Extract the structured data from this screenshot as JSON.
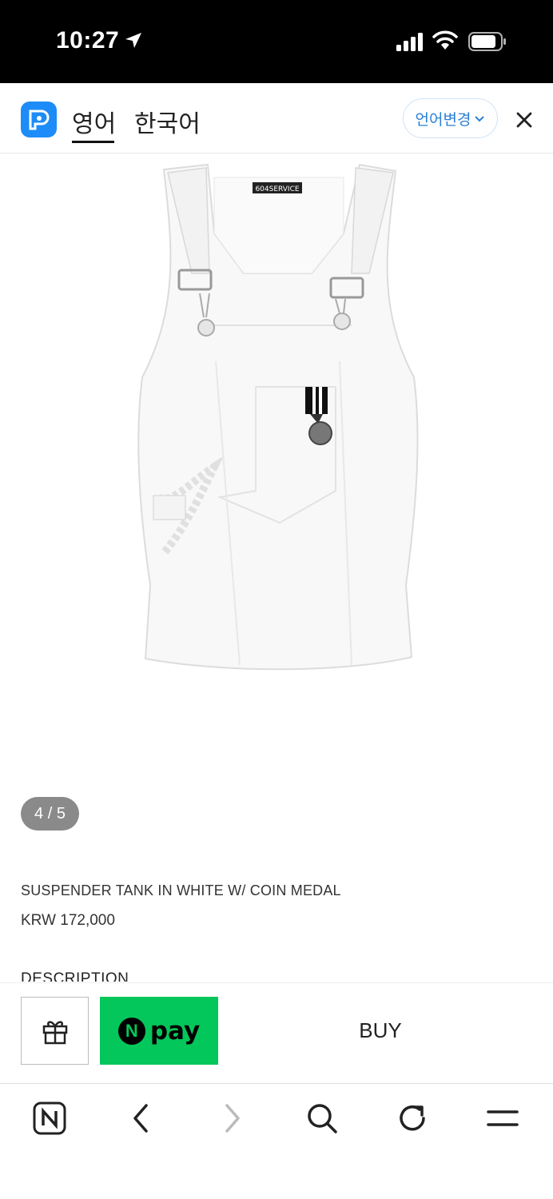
{
  "status_bar": {
    "time": "10:27"
  },
  "translate_bar": {
    "source_lang": "영어",
    "target_lang": "한국어",
    "change_language": "언어변경",
    "colors": {
      "accent": "#1d8cf8"
    }
  },
  "product": {
    "image_label": "604SERVICE",
    "image_counter": "4 / 5",
    "name": "SUSPENDER TANK IN WHITE W/ COIN MEDAL",
    "price": "KRW 172,000",
    "description_heading": "DESCRIPTION"
  },
  "actions": {
    "npay_logo": "N",
    "npay_label": "pay",
    "buy_label": "BUY",
    "colors": {
      "npay": "#03c75a"
    }
  },
  "browser_toolbar": {
    "icons": [
      "naver-home-icon",
      "back-icon",
      "forward-icon",
      "search-icon",
      "refresh-icon",
      "menu-icon"
    ]
  }
}
